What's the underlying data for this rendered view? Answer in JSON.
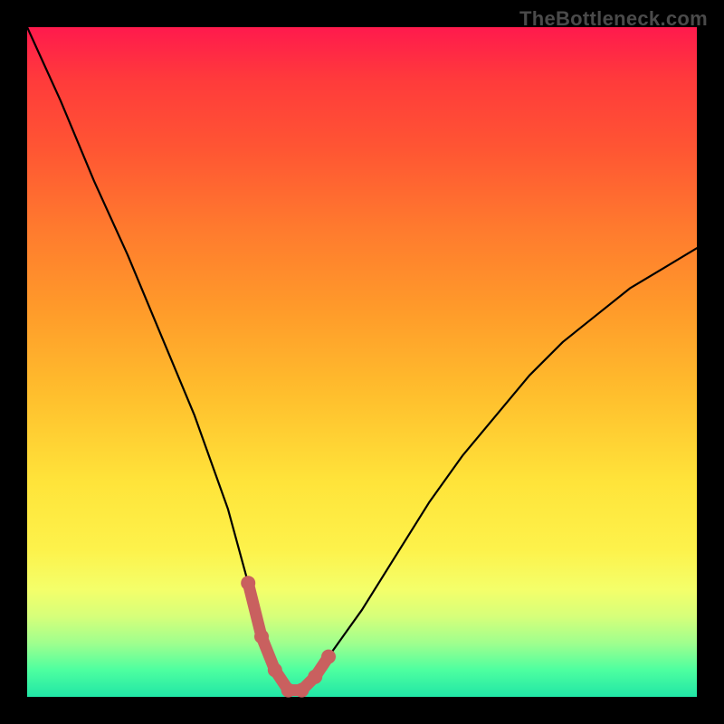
{
  "watermark": "TheBottleneck.com",
  "chart_data": {
    "type": "line",
    "title": "",
    "xlabel": "",
    "ylabel": "",
    "xlim": [
      0,
      100
    ],
    "ylim": [
      0,
      100
    ],
    "series": [
      {
        "name": "bottleneck-curve",
        "x": [
          0,
          5,
          10,
          15,
          20,
          25,
          30,
          33,
          35,
          37,
          39,
          41,
          43,
          45,
          50,
          55,
          60,
          65,
          70,
          75,
          80,
          85,
          90,
          95,
          100
        ],
        "values": [
          100,
          89,
          77,
          66,
          54,
          42,
          28,
          17,
          9,
          4,
          1,
          1,
          3,
          6,
          13,
          21,
          29,
          36,
          42,
          48,
          53,
          57,
          61,
          64,
          67
        ]
      }
    ],
    "highlight": {
      "name": "optimal-range",
      "x": [
        33,
        35,
        37,
        39,
        41,
        43,
        45
      ],
      "values": [
        17,
        9,
        4,
        1,
        1,
        3,
        6
      ],
      "color": "#c9605f"
    },
    "background_gradient": {
      "stops": [
        {
          "pos": 0.0,
          "color": "#ff1a4d"
        },
        {
          "pos": 0.3,
          "color": "#ff7a2e"
        },
        {
          "pos": 0.68,
          "color": "#ffe43a"
        },
        {
          "pos": 0.88,
          "color": "#d6ff7a"
        },
        {
          "pos": 1.0,
          "color": "#21e6a6"
        }
      ]
    }
  }
}
